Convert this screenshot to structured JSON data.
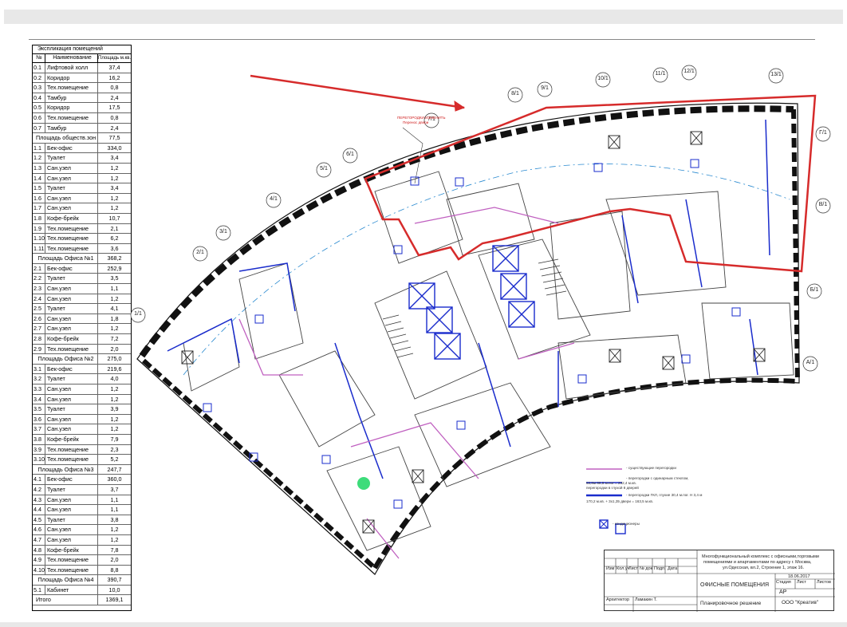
{
  "explication": {
    "title": "Экспликация помещений",
    "header": {
      "num": "№",
      "name": "Наименование",
      "area": "Площадь м.кв."
    },
    "rows": [
      {
        "n": "0.1",
        "name": "Лифтовой холл",
        "area": "37,4"
      },
      {
        "n": "0.2",
        "name": "Коридор",
        "area": "16,2"
      },
      {
        "n": "0.3",
        "name": "Тех.помещение",
        "area": "0,8"
      },
      {
        "n": "0.4",
        "name": "Тамбур",
        "area": "2,4"
      },
      {
        "n": "0.5",
        "name": "Коридор",
        "area": "17,5"
      },
      {
        "n": "0.6",
        "name": "Тех.помещение",
        "area": "0,8"
      },
      {
        "n": "0.7",
        "name": "Тамбур",
        "area": "2,4"
      },
      {
        "n": "",
        "name": "Площадь обществ.зон",
        "area": "77,5",
        "sub": true
      },
      {
        "n": "1.1",
        "name": "Бек-офис",
        "area": "334,0"
      },
      {
        "n": "1.2",
        "name": "Туалет",
        "area": "3,4"
      },
      {
        "n": "1.3",
        "name": "Сан.узел",
        "area": "1,2"
      },
      {
        "n": "1.4",
        "name": "Сан.узел",
        "area": "1,2"
      },
      {
        "n": "1.5",
        "name": "Туалет",
        "area": "3,4"
      },
      {
        "n": "1.6",
        "name": "Сан.узел",
        "area": "1,2"
      },
      {
        "n": "1.7",
        "name": "Сан.узел",
        "area": "1,2"
      },
      {
        "n": "1.8",
        "name": "Кофе-брейк",
        "area": "10,7"
      },
      {
        "n": "1.9",
        "name": "Тех.помещение",
        "area": "2,1"
      },
      {
        "n": "1.10",
        "name": "Тех.помещение",
        "area": "6,2"
      },
      {
        "n": "1.11",
        "name": "Тех.помещение",
        "area": "3,6"
      },
      {
        "n": "",
        "name": "Площадь Офиса №1",
        "area": "368,2",
        "sub": true
      },
      {
        "n": "2.1",
        "name": "Бек-офис",
        "area": "252,9"
      },
      {
        "n": "2.2",
        "name": "Туалет",
        "area": "3,5"
      },
      {
        "n": "2.3",
        "name": "Сан.узел",
        "area": "1,1"
      },
      {
        "n": "2.4",
        "name": "Сан.узел",
        "area": "1,2"
      },
      {
        "n": "2.5",
        "name": "Туалет",
        "area": "4,1"
      },
      {
        "n": "2.6",
        "name": "Сан.узел",
        "area": "1,8"
      },
      {
        "n": "2.7",
        "name": "Сан.узел",
        "area": "1,2"
      },
      {
        "n": "2.8",
        "name": "Кофе-брейк",
        "area": "7,2"
      },
      {
        "n": "2.9",
        "name": "Тех.помещение",
        "area": "2,0"
      },
      {
        "n": "",
        "name": "Площадь Офиса №2",
        "area": "275,0",
        "sub": true
      },
      {
        "n": "3.1",
        "name": "Бек-офис",
        "area": "219,6"
      },
      {
        "n": "3.2",
        "name": "Туалет",
        "area": "4,0"
      },
      {
        "n": "3.3",
        "name": "Сан.узел",
        "area": "1,2"
      },
      {
        "n": "3.4",
        "name": "Сан.узел",
        "area": "1,2"
      },
      {
        "n": "3.5",
        "name": "Туалет",
        "area": "3,9"
      },
      {
        "n": "3.6",
        "name": "Сан.узел",
        "area": "1,2"
      },
      {
        "n": "3.7",
        "name": "Сан.узел",
        "area": "1,2"
      },
      {
        "n": "3.8",
        "name": "Кофе-брейк",
        "area": "7,9"
      },
      {
        "n": "3.9",
        "name": "Тех.помещение",
        "area": "2,3"
      },
      {
        "n": "3.10",
        "name": "Тех.помещение",
        "area": "5,2"
      },
      {
        "n": "",
        "name": "Площадь Офиса №3",
        "area": "247,7",
        "sub": true
      },
      {
        "n": "4.1",
        "name": "Бек-офис",
        "area": "360,0"
      },
      {
        "n": "4.2",
        "name": "Туалет",
        "area": "3,7"
      },
      {
        "n": "4.3",
        "name": "Сан.узел",
        "area": "1,1"
      },
      {
        "n": "4.4",
        "name": "Сан.узел",
        "area": "1,1"
      },
      {
        "n": "4.5",
        "name": "Туалет",
        "area": "3,8"
      },
      {
        "n": "4.6",
        "name": "Сан.узел",
        "area": "1,2"
      },
      {
        "n": "4.7",
        "name": "Сан.узел",
        "area": "1,2"
      },
      {
        "n": "4.8",
        "name": "Кофе-брейк",
        "area": "7,8"
      },
      {
        "n": "4.9",
        "name": "Тех.помещение",
        "area": "2,0"
      },
      {
        "n": "4.10",
        "name": "Тех.помещение",
        "area": "8,8"
      },
      {
        "n": "",
        "name": "Площадь Офиса №4",
        "area": "390,7",
        "sub": true
      },
      {
        "n": "5.1",
        "name": "Кабинет",
        "area": "10,0"
      },
      {
        "n": "",
        "name": "Итого",
        "area": "1369,1"
      }
    ]
  },
  "axes": [
    "1/1",
    "2/1",
    "3/1",
    "4/1",
    "5/1",
    "6/1",
    "7/1",
    "8/1",
    "9/1",
    "10/1",
    "11/1",
    "12/1",
    "13/1",
    "Г/1",
    "В/1",
    "Б/1",
    "А/1"
  ],
  "note": {
    "line1": "ПЕРЕГОРОДКИ ИЗМЕНИТЬ",
    "line2": "Перенос двери"
  },
  "legend": {
    "existing": "- существующие перегородки",
    "glazed_line1": "- перегородки с одинарным стеклом,",
    "glazed_line2": "53,8м  68,5 м.пог = 232,4 м.кв.",
    "glazed_line3": "перегородки в глухой 8 дверей",
    "gkl_line1": "- перегородки ГКЛ, глухие 30,4 м.пог. Н 3,4 м",
    "gkl_line2": "170,2 м.кв. + 3х1,35 двери = 163,5 м.кв.",
    "conditioners": "- кондиционеры"
  },
  "stamp": {
    "project_line1": "Многофункциональный комплекс с офисными,торговыми",
    "project_line2": "помещениями и апартаментами по адресу г. Москва,",
    "project_line3": "ул.Одесская, вл.2, Строение 1, этаж 16.",
    "date": "18.06.2017",
    "sheet_title": "ОФИСНЫЕ ПОМЕЩЕНИЯ",
    "stage_h": "Стадия",
    "sheet_h": "Лист",
    "sheets_h": "Листов",
    "stage": "АР",
    "drawing": "Планировочное решение",
    "company": "ООО \"Креатив\"",
    "cols": [
      "Изм",
      "Кол.уч",
      "Лист",
      "№ док",
      "Подп.",
      "Дата"
    ],
    "architect_role": "Архитектор",
    "architect_name": "Ламакин Т."
  },
  "colors": {
    "accent_red": "#d62b2b",
    "partition_blue": "#1a2ccc",
    "partition_purple": "#c060c0",
    "marker_green": "#3ddc7a"
  }
}
